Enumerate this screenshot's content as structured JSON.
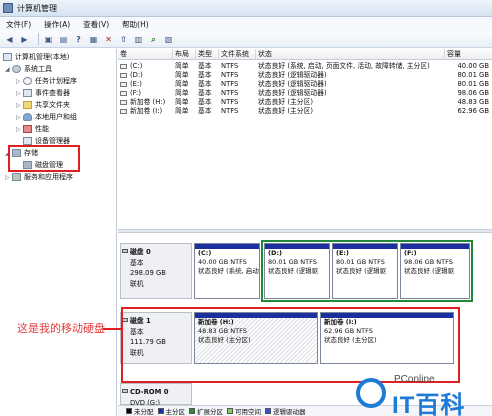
{
  "window": {
    "title": "计算机管理"
  },
  "menu": [
    "文件(F)",
    "操作(A)",
    "查看(V)",
    "帮助(H)"
  ],
  "toolbar_icons": [
    "back-icon",
    "forward-icon",
    "up-folder-icon",
    "properties-icon",
    "help-icon",
    "console-icon",
    "delete-icon",
    "export-icon",
    "open-folder-icon",
    "search-icon",
    "refresh-icon"
  ],
  "tree": {
    "root": "计算机管理(本地)",
    "system_tools": "系统工具",
    "task_scheduler": "任务计划程序",
    "event_viewer": "事件查看器",
    "shared_folders": "共享文件夹",
    "local_users": "本地用户和组",
    "performance": "性能",
    "device_manager": "设备管理器",
    "storage": "存储",
    "disk_management": "磁盘管理",
    "services": "服务和应用程序"
  },
  "volume_table": {
    "headers": [
      "卷",
      "布局",
      "类型",
      "文件系统",
      "状态",
      "容量"
    ],
    "rows": [
      {
        "vol": "(C:)",
        "layout": "简单",
        "type": "基本",
        "fs": "NTFS",
        "status": "状态良好 (系统, 启动, 页面文件, 活动, 故障转储, 主分区)",
        "cap": "40.00 GB"
      },
      {
        "vol": "(D:)",
        "layout": "简单",
        "type": "基本",
        "fs": "NTFS",
        "status": "状态良好 (逻辑驱动器)",
        "cap": "80.01 GB"
      },
      {
        "vol": "(E:)",
        "layout": "简单",
        "type": "基本",
        "fs": "NTFS",
        "status": "状态良好 (逻辑驱动器)",
        "cap": "80.01 GB"
      },
      {
        "vol": "(F:)",
        "layout": "简单",
        "type": "基本",
        "fs": "NTFS",
        "status": "状态良好 (逻辑驱动器)",
        "cap": "98.06 GB"
      },
      {
        "vol": "新加卷 (H:)",
        "layout": "简单",
        "type": "基本",
        "fs": "NTFS",
        "status": "状态良好 (主分区)",
        "cap": "48.83 GB"
      },
      {
        "vol": "新加卷 (I:)",
        "layout": "简单",
        "type": "基本",
        "fs": "NTFS",
        "status": "状态良好 (主分区)",
        "cap": "62.96 GB"
      }
    ]
  },
  "disks": [
    {
      "name": "磁盘 0",
      "type": "基本",
      "size": "298.09 GB",
      "state": "联机",
      "partitions": [
        {
          "name": "(C:)",
          "size": "40.00 GB NTFS",
          "status": "状态良好 (系统, 启动,"
        },
        {
          "name": "(D:)",
          "size": "80.01 GB NTFS",
          "status": "状态良好 (逻辑驱"
        },
        {
          "name": "(E:)",
          "size": "80.01 GB NTFS",
          "status": "状态良好 (逻辑驱"
        },
        {
          "name": "(F:)",
          "size": "98.06 GB NTFS",
          "status": "状态良好 (逻辑驱"
        }
      ]
    },
    {
      "name": "磁盘 1",
      "type": "基本",
      "size": "111.79 GB",
      "state": "联机",
      "partitions": [
        {
          "name": "新加卷 (H:)",
          "size": "48.83 GB NTFS",
          "status": "状态良好 (主分区)"
        },
        {
          "name": "新加卷 (I:)",
          "size": "62.96 GB NTFS",
          "status": "状态良好 (主分区)"
        }
      ]
    },
    {
      "name": "CD-ROM 0",
      "type": "DVD (G:)",
      "size": "",
      "state": ""
    }
  ],
  "legend": [
    "未分配",
    "主分区",
    "扩展分区",
    "可用空间",
    "逻辑驱动器"
  ],
  "legend_colors": [
    "#000000",
    "#1b2f9f",
    "#2e8b2e",
    "#88cc55",
    "#3a4fd8"
  ],
  "annotation": "这是我的移动硬盘",
  "watermark": {
    "top": "PConline",
    "main": "IT百科"
  },
  "colors": {
    "highlight_red": "#e02020",
    "highlight_green": "#1f8a3a",
    "partition_bar": "#1b2f9f"
  }
}
